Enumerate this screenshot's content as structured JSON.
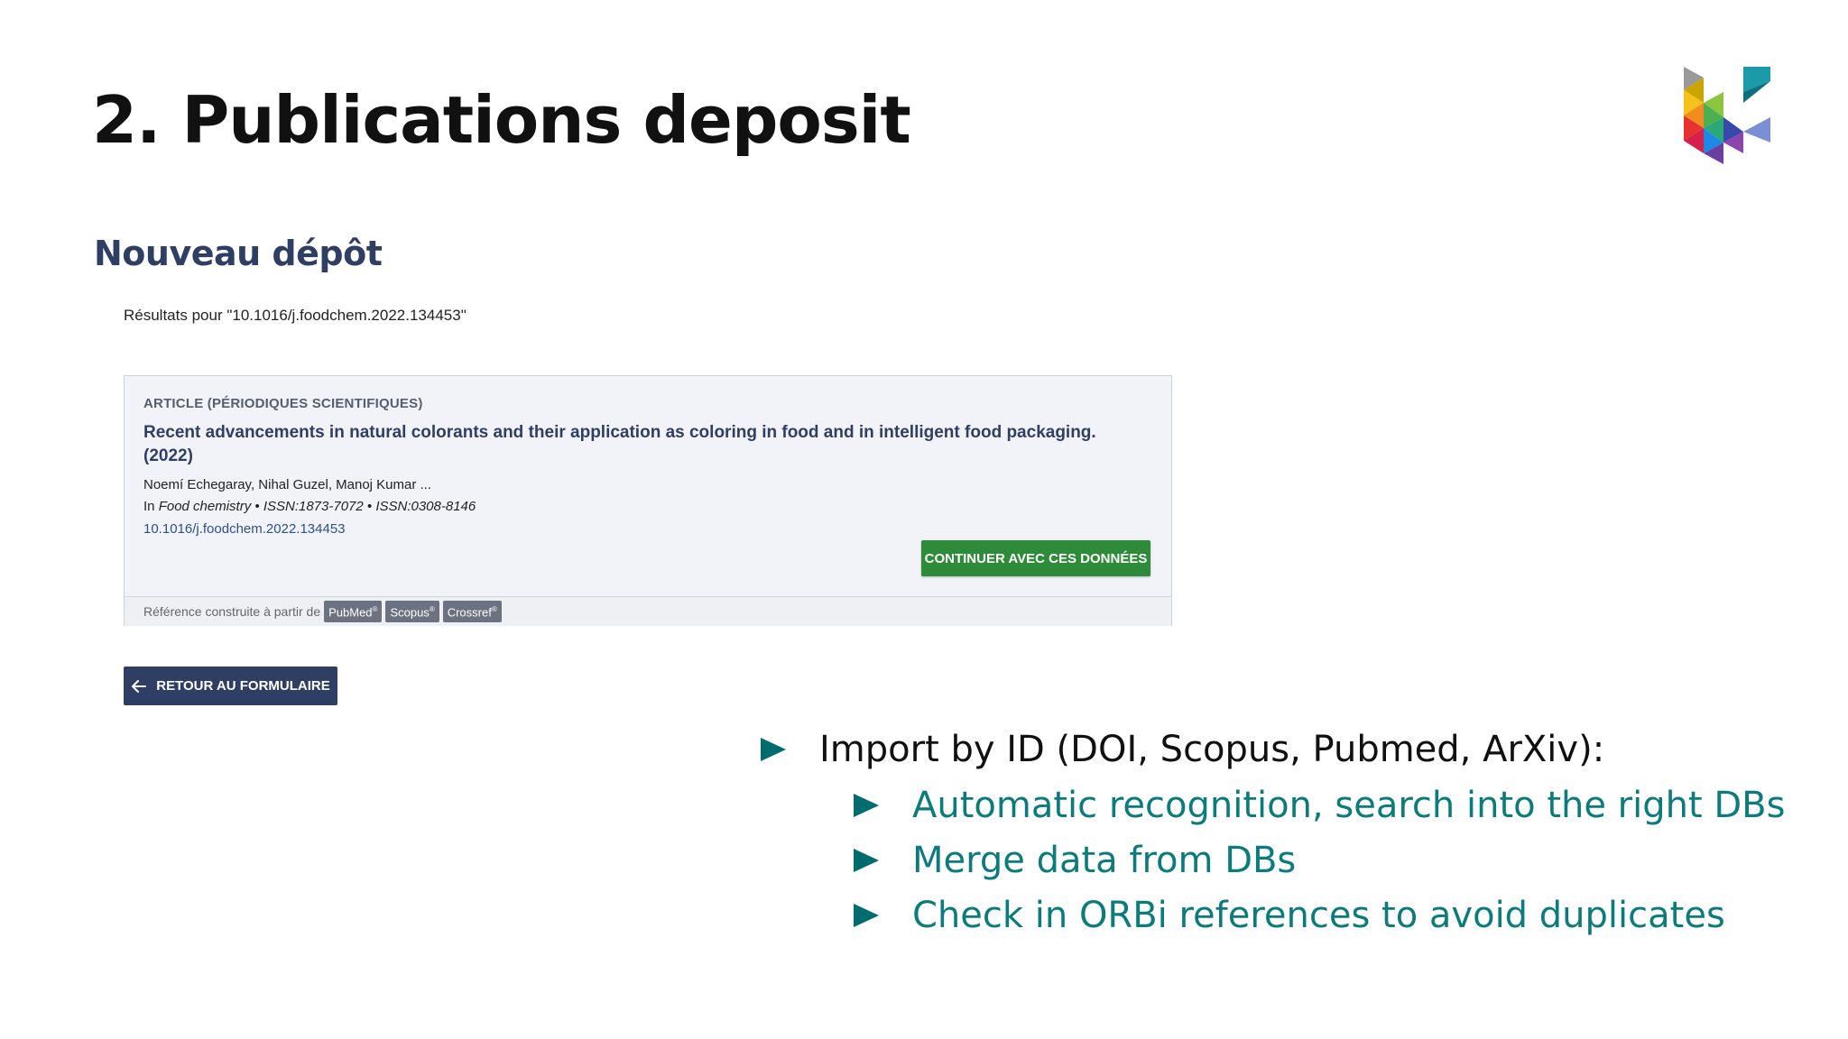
{
  "slide": {
    "title": "2. Publications deposit"
  },
  "deposit": {
    "heading": "Nouveau dépôt",
    "results_line": "Résultats pour \"10.1016/j.foodchem.2022.134453\"",
    "card": {
      "type_label": "ARTICLE (PÉRIODIQUES SCIENTIFIQUES)",
      "title": "Recent advancements in natural colorants and their application as coloring in food and in intelligent food packaging. (2022)",
      "authors": "Noemí Echegaray, Nihal Guzel, Manoj Kumar ...",
      "source_prefix": "In",
      "journal": "Food chemistry",
      "issn_line": "• ISSN:1873-7072 • ISSN:0308-8146",
      "doi": "10.1016/j.foodchem.2022.134453",
      "continue_button": "CONTINUER AVEC CES DONNÉES",
      "footer_label": "Référence construite à partir de",
      "sources": [
        "PubMed",
        "Scopus",
        "Crossref"
      ]
    },
    "back_button": "RETOUR AU FORMULAIRE"
  },
  "bullets": {
    "main": "Import by ID (DOI, Scopus, Pubmed, ArXiv):",
    "sub": [
      "Automatic recognition, search into the right DBs",
      "Merge data from DBs",
      "Check in ORBi references to avoid duplicates"
    ]
  },
  "colors": {
    "heading_navy": "#2f3f63",
    "continue_green": "#2e8b3a",
    "bullet_teal": "#0b7b7b",
    "arrow_teal": "#006c6e"
  },
  "icons": {
    "logo": "university-logo",
    "back": "arrow-left-icon",
    "bullet": "triangle-bullet-icon"
  }
}
